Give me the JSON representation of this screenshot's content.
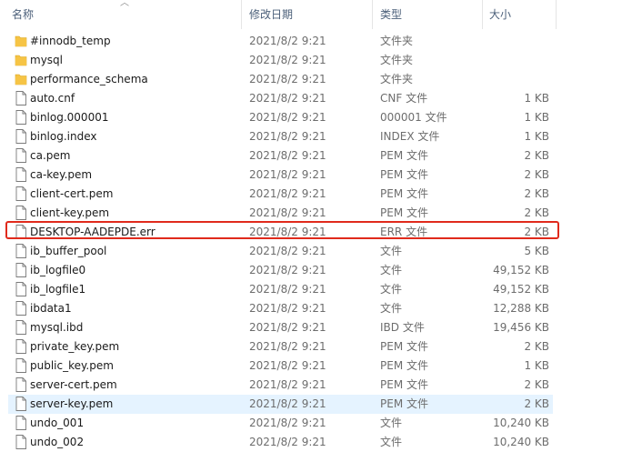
{
  "columns": {
    "name": "名称",
    "date": "修改日期",
    "type": "类型",
    "size": "大小"
  },
  "colors": {
    "folder": "#f6c445",
    "highlight_border": "#e02a1c",
    "hover_row": "#e5f3ff"
  },
  "files": [
    {
      "name": "#innodb_temp",
      "date": "2021/8/2 9:21",
      "type": "文件夹",
      "size": "",
      "icon": "folder-icon"
    },
    {
      "name": "mysql",
      "date": "2021/8/2 9:21",
      "type": "文件夹",
      "size": "",
      "icon": "folder-icon"
    },
    {
      "name": "performance_schema",
      "date": "2021/8/2 9:21",
      "type": "文件夹",
      "size": "",
      "icon": "folder-icon"
    },
    {
      "name": "auto.cnf",
      "date": "2021/8/2 9:21",
      "type": "CNF 文件",
      "size": "1 KB",
      "icon": "file-icon"
    },
    {
      "name": "binlog.000001",
      "date": "2021/8/2 9:21",
      "type": "000001 文件",
      "size": "1 KB",
      "icon": "file-icon"
    },
    {
      "name": "binlog.index",
      "date": "2021/8/2 9:21",
      "type": "INDEX 文件",
      "size": "1 KB",
      "icon": "file-icon"
    },
    {
      "name": "ca.pem",
      "date": "2021/8/2 9:21",
      "type": "PEM 文件",
      "size": "2 KB",
      "icon": "file-icon"
    },
    {
      "name": "ca-key.pem",
      "date": "2021/8/2 9:21",
      "type": "PEM 文件",
      "size": "2 KB",
      "icon": "file-icon"
    },
    {
      "name": "client-cert.pem",
      "date": "2021/8/2 9:21",
      "type": "PEM 文件",
      "size": "2 KB",
      "icon": "file-icon"
    },
    {
      "name": "client-key.pem",
      "date": "2021/8/2 9:21",
      "type": "PEM 文件",
      "size": "2 KB",
      "icon": "file-icon"
    },
    {
      "name": "DESKTOP-AADEPDE.err",
      "date": "2021/8/2 9:21",
      "type": "ERR 文件",
      "size": "2 KB",
      "icon": "file-icon"
    },
    {
      "name": "ib_buffer_pool",
      "date": "2021/8/2 9:21",
      "type": "文件",
      "size": "5 KB",
      "icon": "file-icon"
    },
    {
      "name": "ib_logfile0",
      "date": "2021/8/2 9:21",
      "type": "文件",
      "size": "49,152 KB",
      "icon": "file-icon"
    },
    {
      "name": "ib_logfile1",
      "date": "2021/8/2 9:21",
      "type": "文件",
      "size": "49,152 KB",
      "icon": "file-icon"
    },
    {
      "name": "ibdata1",
      "date": "2021/8/2 9:21",
      "type": "文件",
      "size": "12,288 KB",
      "icon": "file-icon"
    },
    {
      "name": "mysql.ibd",
      "date": "2021/8/2 9:21",
      "type": "IBD 文件",
      "size": "19,456 KB",
      "icon": "file-icon"
    },
    {
      "name": "private_key.pem",
      "date": "2021/8/2 9:21",
      "type": "PEM 文件",
      "size": "2 KB",
      "icon": "file-icon"
    },
    {
      "name": "public_key.pem",
      "date": "2021/8/2 9:21",
      "type": "PEM 文件",
      "size": "1 KB",
      "icon": "file-icon"
    },
    {
      "name": "server-cert.pem",
      "date": "2021/8/2 9:21",
      "type": "PEM 文件",
      "size": "2 KB",
      "icon": "file-icon"
    },
    {
      "name": "server-key.pem",
      "date": "2021/8/2 9:21",
      "type": "PEM 文件",
      "size": "2 KB",
      "icon": "file-icon",
      "hover": true
    },
    {
      "name": "undo_001",
      "date": "2021/8/2 9:21",
      "type": "文件",
      "size": "10,240 KB",
      "icon": "file-icon"
    },
    {
      "name": "undo_002",
      "date": "2021/8/2 9:21",
      "type": "文件",
      "size": "10,240 KB",
      "icon": "file-icon"
    }
  ]
}
